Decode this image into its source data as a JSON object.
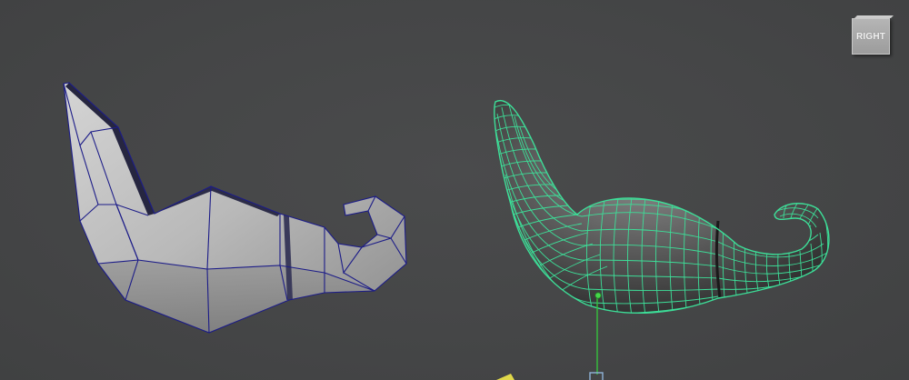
{
  "viewport": {
    "view_label": "RIGHT",
    "background_color": "#454647"
  },
  "objects": [
    {
      "name": "low-poly-mustache",
      "display_mode": "shaded-wireframe",
      "wire_color": "#1e1e8c"
    },
    {
      "name": "smooth-mustache",
      "display_mode": "selected-wireframe",
      "wire_color": "#3dde98"
    }
  ],
  "manipulator": {
    "axis_color": "#35c23c",
    "handle_color": "#8fb3d8"
  }
}
